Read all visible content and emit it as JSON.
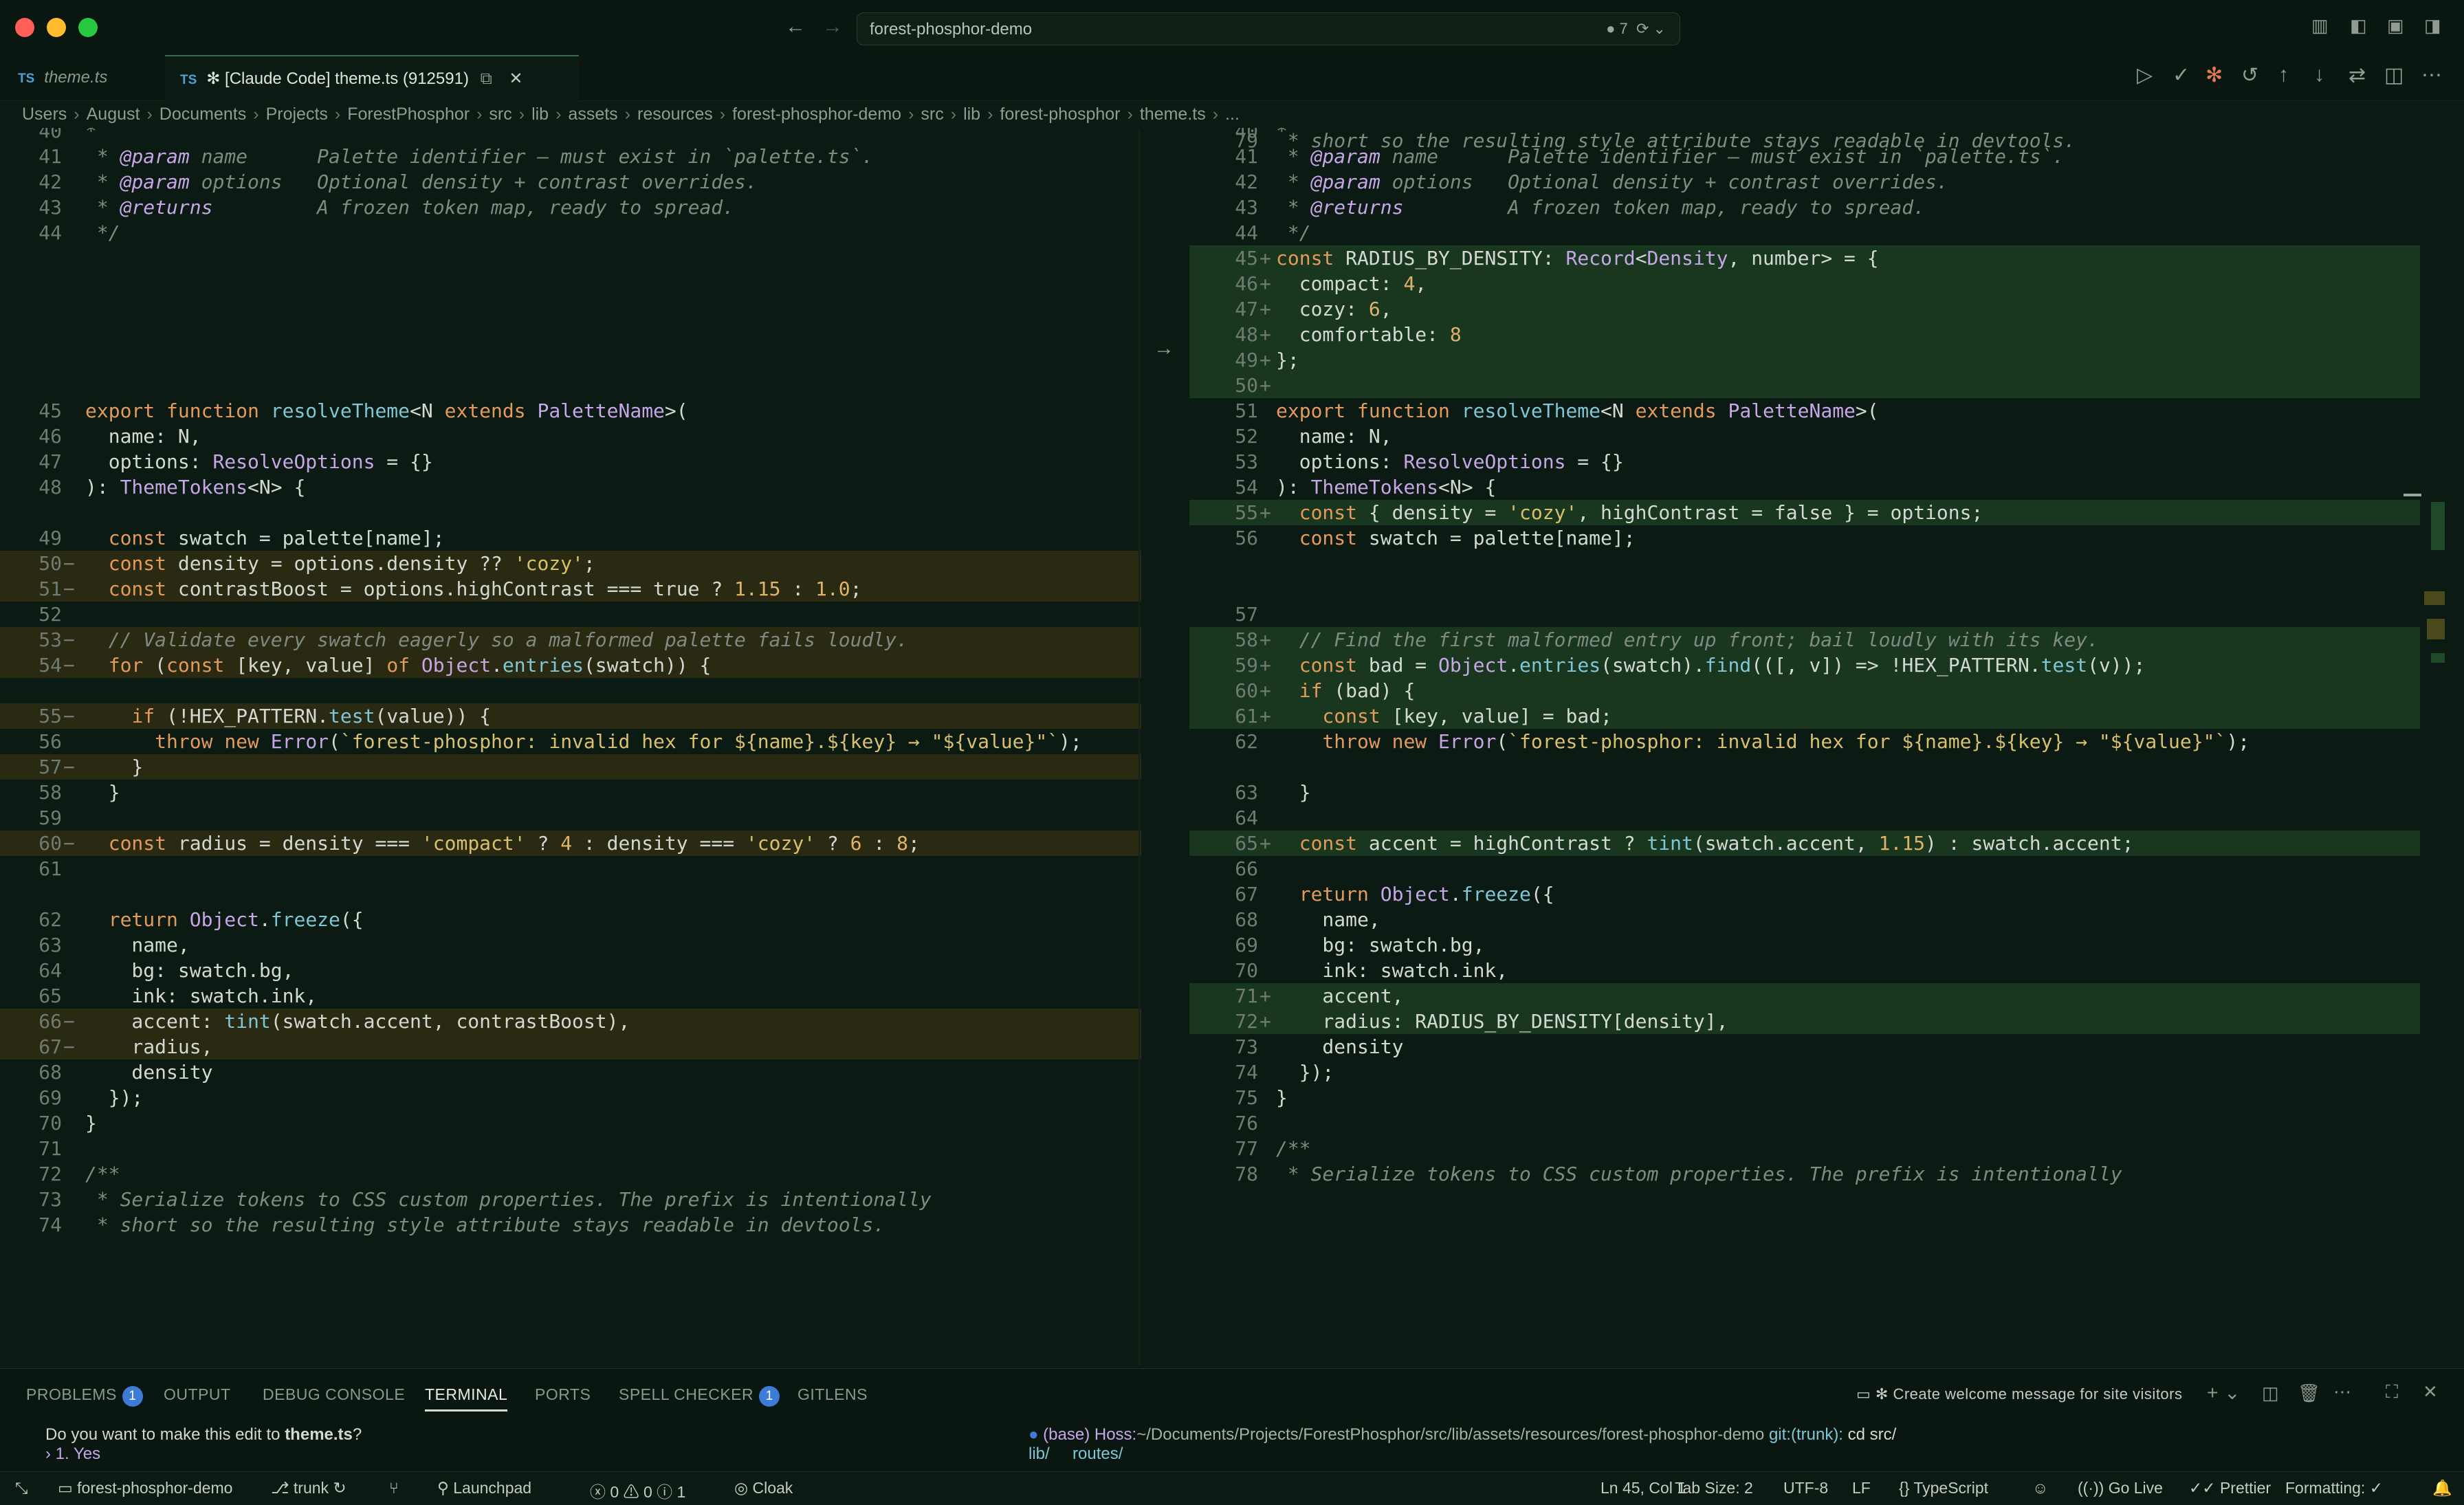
{
  "window": {
    "search_text": "forest-phosphor-demo",
    "changes_badge": "● 7"
  },
  "tabs": [
    {
      "label": "theme.ts",
      "icon": "TS"
    },
    {
      "label": "✻ [Claude Code] theme.ts (912591)",
      "icon": "TS"
    }
  ],
  "breadcrumb": [
    "Users",
    "August",
    "Documents",
    "Projects",
    "ForestPhosphor",
    "src",
    "lib",
    "assets",
    "resources",
    "forest-phosphor-demo",
    "src",
    "lib",
    "forest-phosphor",
    "theme.ts",
    "..."
  ],
  "left_lines": [
    {
      "n": "40",
      "m": "",
      "t": "*"
    },
    {
      "n": "41",
      "m": "",
      "t": " * @param name      Palette identifier — must exist in `palette.ts`."
    },
    {
      "n": "42",
      "m": "",
      "t": " * @param options   Optional density + contrast overrides."
    },
    {
      "n": "43",
      "m": "",
      "t": " * @returns         A frozen token map, ready to spread."
    },
    {
      "n": "44",
      "m": "",
      "t": " */"
    },
    {
      "n": "45",
      "m": "",
      "t": "export function resolveTheme<N extends PaletteName>("
    },
    {
      "n": "46",
      "m": "",
      "t": "  name: N,"
    },
    {
      "n": "47",
      "m": "",
      "t": "  options: ResolveOptions = {}"
    },
    {
      "n": "48",
      "m": "",
      "t": "): ThemeTokens<N> {"
    },
    {
      "n": "49",
      "m": "",
      "t": "  const swatch = palette[name];"
    },
    {
      "n": "50",
      "m": "−",
      "t": "  const density = options.density ?? 'cozy';"
    },
    {
      "n": "51",
      "m": "−",
      "t": "  const contrastBoost = options.highContrast === true ? 1.15 : 1.0;"
    },
    {
      "n": "52",
      "m": "",
      "t": ""
    },
    {
      "n": "53",
      "m": "−",
      "t": "  // Validate every swatch eagerly so a malformed palette fails loudly."
    },
    {
      "n": "54",
      "m": "−",
      "t": "  for (const [key, value] of Object.entries(swatch)) {"
    },
    {
      "n": "55",
      "m": "−",
      "t": "    if (!HEX_PATTERN.test(value)) {"
    },
    {
      "n": "56",
      "m": "",
      "t": "      throw new Error(`forest-phosphor: invalid hex for ${name}.${key} → \"${value}\"`);"
    },
    {
      "n": "57",
      "m": "−",
      "t": "    }"
    },
    {
      "n": "58",
      "m": "",
      "t": "  }"
    },
    {
      "n": "59",
      "m": "",
      "t": ""
    },
    {
      "n": "60",
      "m": "−",
      "t": "  const radius = density === 'compact' ? 4 : density === 'cozy' ? 6 : 8;"
    },
    {
      "n": "61",
      "m": "",
      "t": ""
    },
    {
      "n": "62",
      "m": "",
      "t": "  return Object.freeze({"
    },
    {
      "n": "63",
      "m": "",
      "t": "    name,"
    },
    {
      "n": "64",
      "m": "",
      "t": "    bg: swatch.bg,"
    },
    {
      "n": "65",
      "m": "",
      "t": "    ink: swatch.ink,"
    },
    {
      "n": "66",
      "m": "−",
      "t": "    accent: tint(swatch.accent, contrastBoost),"
    },
    {
      "n": "67",
      "m": "−",
      "t": "    radius,"
    },
    {
      "n": "68",
      "m": "",
      "t": "    density"
    },
    {
      "n": "69",
      "m": "",
      "t": "  });"
    },
    {
      "n": "70",
      "m": "",
      "t": "}"
    },
    {
      "n": "71",
      "m": "",
      "t": ""
    },
    {
      "n": "72",
      "m": "",
      "t": "/**"
    },
    {
      "n": "73",
      "m": "",
      "t": " * Serialize tokens to CSS custom properties. The prefix is intentionally"
    },
    {
      "n": "74",
      "m": "",
      "t": " * short so the resulting style attribute stays readable in devtools."
    }
  ],
  "right_lines": [
    {
      "n": "40",
      "m": "",
      "t": "*"
    },
    {
      "n": "41",
      "m": "",
      "t": " * @param name      Palette identifier — must exist in `palette.ts`."
    },
    {
      "n": "42",
      "m": "",
      "t": " * @param options   Optional density + contrast overrides."
    },
    {
      "n": "43",
      "m": "",
      "t": " * @returns         A frozen token map, ready to spread."
    },
    {
      "n": "44",
      "m": "",
      "t": " */"
    },
    {
      "n": "45",
      "m": "+",
      "t": "const RADIUS_BY_DENSITY: Record<Density, number> = {"
    },
    {
      "n": "46",
      "m": "+",
      "t": "  compact: 4,"
    },
    {
      "n": "47",
      "m": "+",
      "t": "  cozy: 6,"
    },
    {
      "n": "48",
      "m": "+",
      "t": "  comfortable: 8"
    },
    {
      "n": "49",
      "m": "+",
      "t": "};"
    },
    {
      "n": "50",
      "m": "+",
      "t": ""
    },
    {
      "n": "51",
      "m": "",
      "t": "export function resolveTheme<N extends PaletteName>("
    },
    {
      "n": "52",
      "m": "",
      "t": "  name: N,"
    },
    {
      "n": "53",
      "m": "",
      "t": "  options: ResolveOptions = {}"
    },
    {
      "n": "54",
      "m": "",
      "t": "): ThemeTokens<N> {"
    },
    {
      "n": "55",
      "m": "+",
      "t": "  const { density = 'cozy', highContrast = false } = options;"
    },
    {
      "n": "56",
      "m": "",
      "t": "  const swatch = palette[name];"
    },
    {
      "n": "57",
      "m": "",
      "t": ""
    },
    {
      "n": "58",
      "m": "+",
      "t": "  // Find the first malformed entry up front; bail loudly with its key."
    },
    {
      "n": "59",
      "m": "+",
      "t": "  const bad = Object.entries(swatch).find(([, v]) => !HEX_PATTERN.test(v));"
    },
    {
      "n": "60",
      "m": "+",
      "t": "  if (bad) {"
    },
    {
      "n": "61",
      "m": "+",
      "t": "    const [key, value] = bad;"
    },
    {
      "n": "62",
      "m": "",
      "t": "    throw new Error(`forest-phosphor: invalid hex for ${name}.${key} → \"${value}\"`);"
    },
    {
      "n": "63",
      "m": "",
      "t": "  }"
    },
    {
      "n": "64",
      "m": "",
      "t": ""
    },
    {
      "n": "65",
      "m": "+",
      "t": "  const accent = highContrast ? tint(swatch.accent, 1.15) : swatch.accent;"
    },
    {
      "n": "66",
      "m": "",
      "t": ""
    },
    {
      "n": "67",
      "m": "",
      "t": "  return Object.freeze({"
    },
    {
      "n": "68",
      "m": "",
      "t": "    name,"
    },
    {
      "n": "69",
      "m": "",
      "t": "    bg: swatch.bg,"
    },
    {
      "n": "70",
      "m": "",
      "t": "    ink: swatch.ink,"
    },
    {
      "n": "71",
      "m": "+",
      "t": "    accent,"
    },
    {
      "n": "72",
      "m": "+",
      "t": "    radius: RADIUS_BY_DENSITY[density],"
    },
    {
      "n": "73",
      "m": "",
      "t": "    density"
    },
    {
      "n": "74",
      "m": "",
      "t": "  });"
    },
    {
      "n": "75",
      "m": "",
      "t": "}"
    },
    {
      "n": "76",
      "m": "",
      "t": ""
    },
    {
      "n": "77",
      "m": "",
      "t": "/**"
    },
    {
      "n": "78",
      "m": "",
      "t": " * Serialize tokens to CSS custom properties. The prefix is intentionally"
    },
    {
      "n": "79",
      "m": "",
      "t": " * short so the resulting style attribute stays readable in devtools."
    }
  ],
  "panel": {
    "tabs": [
      {
        "label": "PROBLEMS",
        "badge": "1"
      },
      {
        "label": "OUTPUT",
        "badge": ""
      },
      {
        "label": "DEBUG CONSOLE",
        "badge": ""
      },
      {
        "label": "TERMINAL",
        "badge": ""
      },
      {
        "label": "PORTS",
        "badge": ""
      },
      {
        "label": "SPELL CHECKER",
        "badge": "1"
      },
      {
        "label": "GITLENS",
        "badge": ""
      }
    ],
    "terminal_task": "✻ Create welcome message for site visitors",
    "left_prompt": "Do you want to make this edit to ",
    "left_file": "theme.ts",
    "left_prompt_end": "?",
    "left_option": "› 1. Yes",
    "right_prefix": "(base) Hoss:",
    "right_path": "~/Documents/Projects/ForestPhosphor/src/lib/assets/resources/forest-phosphor-demo",
    "right_git": " git:(trunk):",
    "right_cmd": " cd src/",
    "right_ls": "lib/     routes/"
  },
  "status": {
    "workspace": "forest-phosphor-demo",
    "branch": "trunk",
    "launchpad": "Launchpad",
    "errors": "0",
    "warnings": "0",
    "infos": "1",
    "cloak": "Cloak",
    "position": "Ln 45, Col 1",
    "tab_size": "Tab Size: 2",
    "encoding": "UTF-8",
    "eol": "LF",
    "language": "TypeScript",
    "golive": "Go Live",
    "prettier": "Prettier",
    "formatting": "Formatting: ✓"
  },
  "colors": {
    "add_bg": "#19371f",
    "del_bg": "#2a2a12",
    "accent": "#3c7bd6"
  }
}
